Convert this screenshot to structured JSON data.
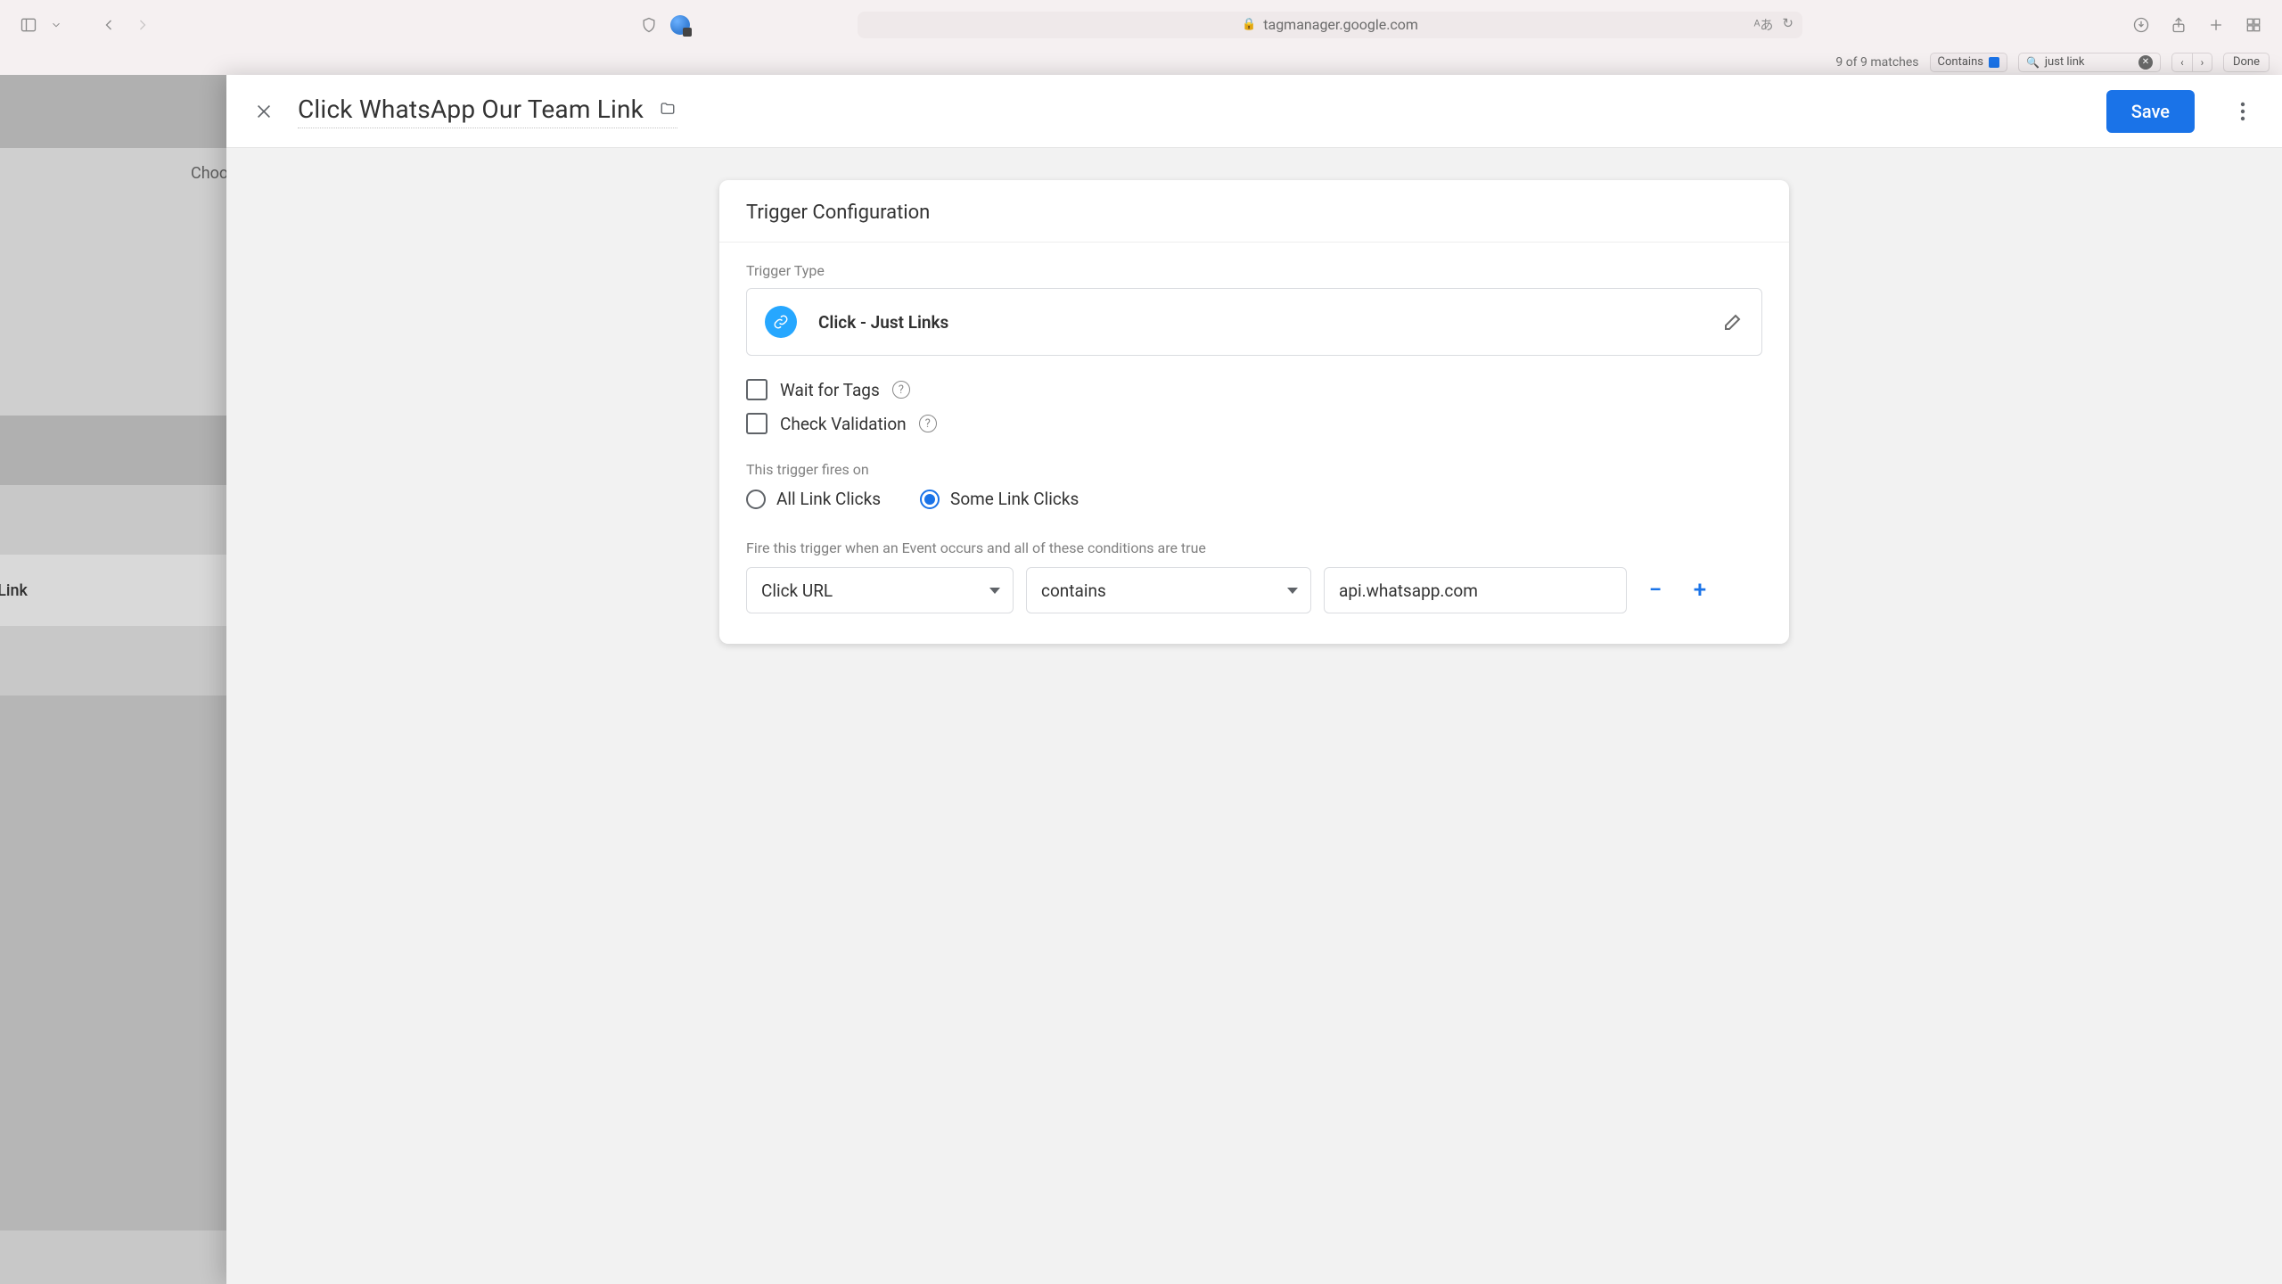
{
  "browser": {
    "url_host": "tagmanager.google.com"
  },
  "find": {
    "matches": "9 of 9 matches",
    "mode": "Contains",
    "query": "just link",
    "done": "Done"
  },
  "background": {
    "hint_fragment": "Choo",
    "selected_row_fragment": "pp Our Team Link"
  },
  "panel": {
    "title": "Click WhatsApp Our Team Link",
    "save": "Save"
  },
  "card": {
    "heading": "Trigger Configuration",
    "trigger_type_label": "Trigger Type",
    "trigger_type_name": "Click - Just Links",
    "wait_for_tags": "Wait for Tags",
    "check_validation": "Check Validation",
    "fires_on_label": "This trigger fires on",
    "radio_all": "All Link Clicks",
    "radio_some": "Some Link Clicks",
    "conditions_label": "Fire this trigger when an Event occurs and all of these conditions are true",
    "cond_variable": "Click URL",
    "cond_operator": "contains",
    "cond_value": "api.whatsapp.com"
  }
}
